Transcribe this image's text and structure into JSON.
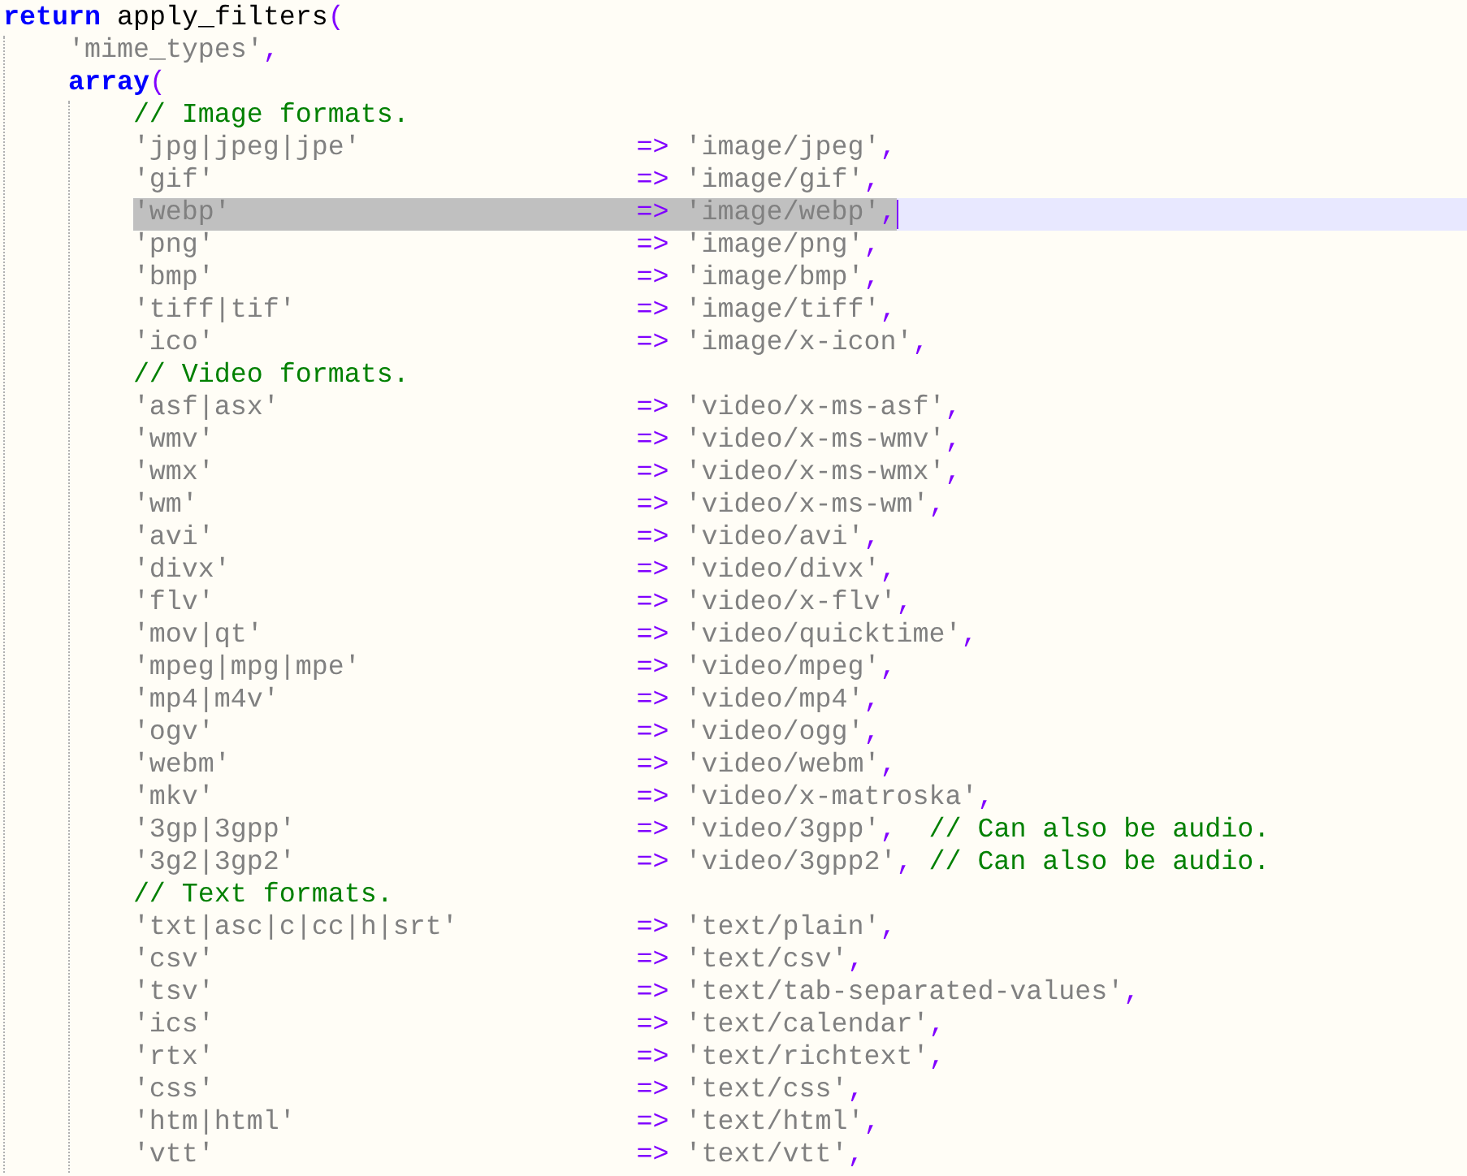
{
  "code": [
    {
      "kind": "call",
      "keyword": "return",
      "name": "apply_filters",
      "paren": "(",
      "children": [
        {
          "kind": "string",
          "text": "'mime_types'",
          "punct": ","
        },
        {
          "kind": "array",
          "keyword": "array",
          "paren": "(",
          "children": [
            {
              "kind": "comment",
              "text": "// Image formats."
            },
            {
              "kind": "pair",
              "key": "'jpg|jpeg|jpe'",
              "arrow": "=>",
              "value": "'image/jpeg'",
              "punct": ",",
              "selected": false
            },
            {
              "kind": "pair",
              "key": "'gif'",
              "arrow": "=>",
              "value": "'image/gif'",
              "punct": ",",
              "selected": false
            },
            {
              "kind": "pair",
              "key": "'webp'",
              "arrow": "=>",
              "value": "'image/webp'",
              "punct": ",",
              "selected": true
            },
            {
              "kind": "pair",
              "key": "'png'",
              "arrow": "=>",
              "value": "'image/png'",
              "punct": ",",
              "selected": false
            },
            {
              "kind": "pair",
              "key": "'bmp'",
              "arrow": "=>",
              "value": "'image/bmp'",
              "punct": ",",
              "selected": false
            },
            {
              "kind": "pair",
              "key": "'tiff|tif'",
              "arrow": "=>",
              "value": "'image/tiff'",
              "punct": ",",
              "selected": false
            },
            {
              "kind": "pair",
              "key": "'ico'",
              "arrow": "=>",
              "value": "'image/x-icon'",
              "punct": ",",
              "selected": false
            },
            {
              "kind": "comment",
              "text": "// Video formats."
            },
            {
              "kind": "pair",
              "key": "'asf|asx'",
              "arrow": "=>",
              "value": "'video/x-ms-asf'",
              "punct": ",",
              "selected": false
            },
            {
              "kind": "pair",
              "key": "'wmv'",
              "arrow": "=>",
              "value": "'video/x-ms-wmv'",
              "punct": ",",
              "selected": false
            },
            {
              "kind": "pair",
              "key": "'wmx'",
              "arrow": "=>",
              "value": "'video/x-ms-wmx'",
              "punct": ",",
              "selected": false
            },
            {
              "kind": "pair",
              "key": "'wm'",
              "arrow": "=>",
              "value": "'video/x-ms-wm'",
              "punct": ",",
              "selected": false
            },
            {
              "kind": "pair",
              "key": "'avi'",
              "arrow": "=>",
              "value": "'video/avi'",
              "punct": ",",
              "selected": false
            },
            {
              "kind": "pair",
              "key": "'divx'",
              "arrow": "=>",
              "value": "'video/divx'",
              "punct": ",",
              "selected": false
            },
            {
              "kind": "pair",
              "key": "'flv'",
              "arrow": "=>",
              "value": "'video/x-flv'",
              "punct": ",",
              "selected": false
            },
            {
              "kind": "pair",
              "key": "'mov|qt'",
              "arrow": "=>",
              "value": "'video/quicktime'",
              "punct": ",",
              "selected": false
            },
            {
              "kind": "pair",
              "key": "'mpeg|mpg|mpe'",
              "arrow": "=>",
              "value": "'video/mpeg'",
              "punct": ",",
              "selected": false
            },
            {
              "kind": "pair",
              "key": "'mp4|m4v'",
              "arrow": "=>",
              "value": "'video/mp4'",
              "punct": ",",
              "selected": false
            },
            {
              "kind": "pair",
              "key": "'ogv'",
              "arrow": "=>",
              "value": "'video/ogg'",
              "punct": ",",
              "selected": false
            },
            {
              "kind": "pair",
              "key": "'webm'",
              "arrow": "=>",
              "value": "'video/webm'",
              "punct": ",",
              "selected": false
            },
            {
              "kind": "pair",
              "key": "'mkv'",
              "arrow": "=>",
              "value": "'video/x-matroska'",
              "punct": ",",
              "selected": false
            },
            {
              "kind": "pair",
              "key": "'3gp|3gpp'",
              "arrow": "=>",
              "value": "'video/3gpp'",
              "punct": ",",
              "comment": "// Can also be audio.",
              "selected": false
            },
            {
              "kind": "pair",
              "key": "'3g2|3gp2'",
              "arrow": "=>",
              "value": "'video/3gpp2'",
              "punct": ",",
              "comment": "// Can also be audio.",
              "selected": false
            },
            {
              "kind": "comment",
              "text": "// Text formats."
            },
            {
              "kind": "pair",
              "key": "'txt|asc|c|cc|h|srt'",
              "arrow": "=>",
              "value": "'text/plain'",
              "punct": ",",
              "selected": false
            },
            {
              "kind": "pair",
              "key": "'csv'",
              "arrow": "=>",
              "value": "'text/csv'",
              "punct": ",",
              "selected": false
            },
            {
              "kind": "pair",
              "key": "'tsv'",
              "arrow": "=>",
              "value": "'text/tab-separated-values'",
              "punct": ",",
              "selected": false
            },
            {
              "kind": "pair",
              "key": "'ics'",
              "arrow": "=>",
              "value": "'text/calendar'",
              "punct": ",",
              "selected": false
            },
            {
              "kind": "pair",
              "key": "'rtx'",
              "arrow": "=>",
              "value": "'text/richtext'",
              "punct": ",",
              "selected": false
            },
            {
              "kind": "pair",
              "key": "'css'",
              "arrow": "=>",
              "value": "'text/css'",
              "punct": ",",
              "selected": false
            },
            {
              "kind": "pair",
              "key": "'htm|html'",
              "arrow": "=>",
              "value": "'text/html'",
              "punct": ",",
              "selected": false
            },
            {
              "kind": "pair",
              "key": "'vtt'",
              "arrow": "=>",
              "value": "'text/vtt'",
              "punct": ",",
              "selected": false
            }
          ]
        }
      ]
    }
  ]
}
